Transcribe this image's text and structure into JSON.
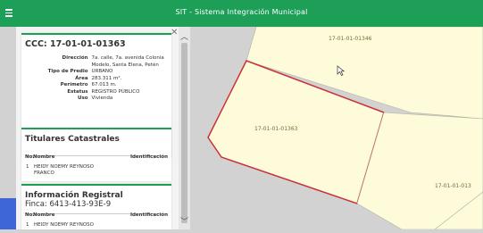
{
  "app": {
    "title": "SIT - Sistema Integración Municipal"
  },
  "panel": {
    "ccc_heading": "CCC: 17-01-01-01363",
    "details": [
      {
        "label": "Dirección",
        "value": "7a. calle, 7a. avenida Colonia Modelo, Santa Elena, Petén"
      },
      {
        "label": "Tipo de Predio",
        "value": "URBANO"
      },
      {
        "label": "Área",
        "value": "283.311 m²."
      },
      {
        "label": "Perímetro",
        "value": "67.013 m."
      },
      {
        "label": "Estatus",
        "value": "REGISTRO PÚBLICO"
      },
      {
        "label": "Uso",
        "value": "Vivienda"
      }
    ],
    "titulares": {
      "heading": "Titulares Catastrales",
      "columns": [
        "No.",
        "Nombre",
        "Identificación"
      ],
      "rows": [
        {
          "no": "1",
          "nombre": "HEIDY NOEMY REYNOSO FRANCO"
        }
      ]
    },
    "registral": {
      "heading": "Información Registral",
      "finca": "Finca: 6413-413-93E-9",
      "columns": [
        "No.",
        "Nombre",
        "Identificación"
      ],
      "rows": [
        {
          "no": "1",
          "nombre": "HEIDY NOEMY REYNOSO"
        }
      ]
    }
  },
  "map": {
    "parcel_labels": [
      "17-01-01-01346",
      "17-01-01-01363",
      "17-01-01-013"
    ],
    "colors": {
      "parcel_fill": "#fdfbd9",
      "road": "#d2d2d2",
      "selected_outline": "#c8323c"
    }
  },
  "icons": {
    "menu": "hamburger-icon",
    "close": "close-icon",
    "scroll_up": "chevron-up-icon",
    "scroll_down": "chevron-down-icon",
    "cursor": "mouse-pointer-icon"
  }
}
